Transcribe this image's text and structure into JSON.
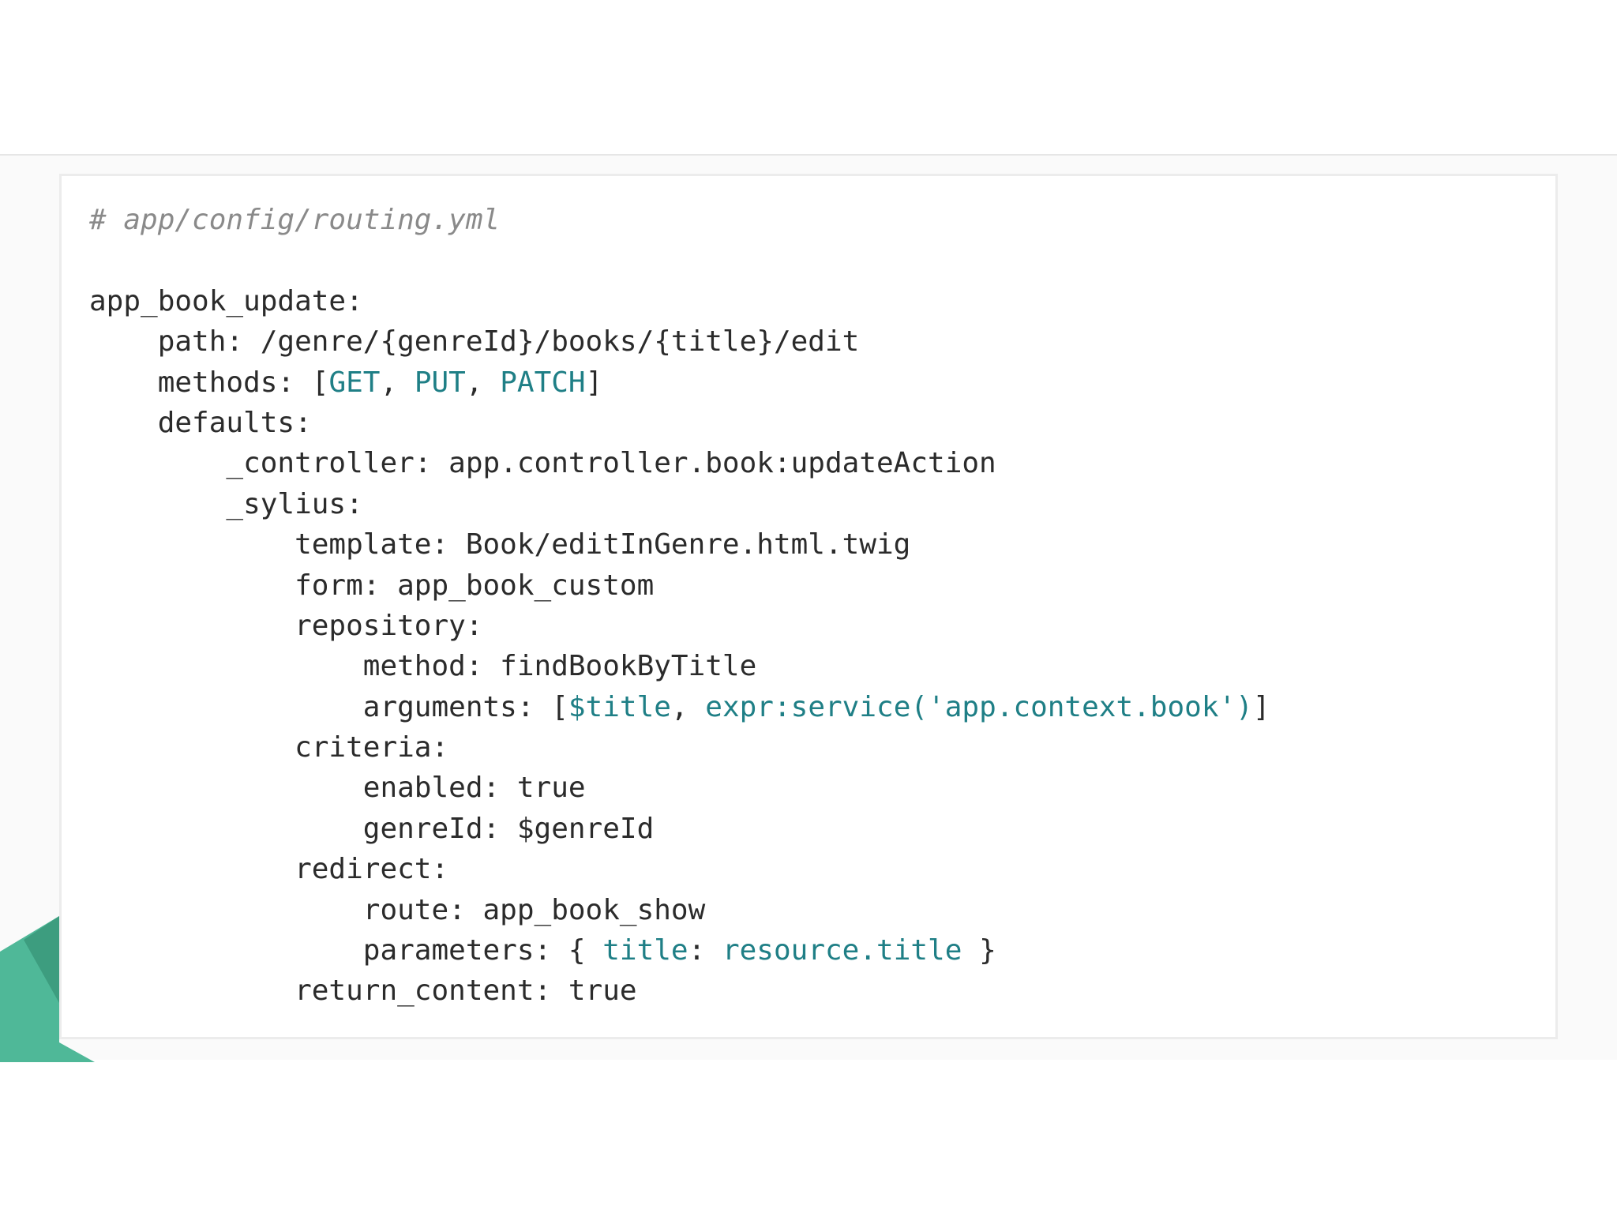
{
  "colors": {
    "accent_teal": "#1f7f86",
    "comment_gray": "#8a8a8a",
    "text": "#2b2b2b",
    "deco_green_light": "#4fb898",
    "deco_green_dark": "#3d9d7f"
  },
  "code": {
    "lines": [
      [
        {
          "t": "# app/config/routing.yml",
          "c": "cmt"
        }
      ],
      [],
      [
        {
          "t": "app_book_update:"
        }
      ],
      [
        {
          "t": "    path: /genre/{genreId}/books/{title}/edit"
        }
      ],
      [
        {
          "t": "    methods: ["
        },
        {
          "t": "GET",
          "c": "kw"
        },
        {
          "t": ", "
        },
        {
          "t": "PUT",
          "c": "kw"
        },
        {
          "t": ", "
        },
        {
          "t": "PATCH",
          "c": "kw"
        },
        {
          "t": "]"
        }
      ],
      [
        {
          "t": "    defaults:"
        }
      ],
      [
        {
          "t": "        _controller: app.controller.book:updateAction"
        }
      ],
      [
        {
          "t": "        _sylius:"
        }
      ],
      [
        {
          "t": "            template: Book/editInGenre.html.twig"
        }
      ],
      [
        {
          "t": "            form: app_book_custom"
        }
      ],
      [
        {
          "t": "            repository:"
        }
      ],
      [
        {
          "t": "                method: findBookByTitle"
        }
      ],
      [
        {
          "t": "                arguments: ["
        },
        {
          "t": "$title",
          "c": "kw"
        },
        {
          "t": ", "
        },
        {
          "t": "expr:service('app.context.book')",
          "c": "kw"
        },
        {
          "t": "]"
        }
      ],
      [
        {
          "t": "            criteria:"
        }
      ],
      [
        {
          "t": "                enabled: true"
        }
      ],
      [
        {
          "t": "                genreId: $genreId"
        }
      ],
      [
        {
          "t": "            redirect:"
        }
      ],
      [
        {
          "t": "                route: app_book_show"
        }
      ],
      [
        {
          "t": "                parameters: { "
        },
        {
          "t": "title",
          "c": "kw"
        },
        {
          "t": ": "
        },
        {
          "t": "resource.title",
          "c": "kw"
        },
        {
          "t": " }"
        }
      ],
      [
        {
          "t": "            return_content: true"
        }
      ]
    ]
  }
}
